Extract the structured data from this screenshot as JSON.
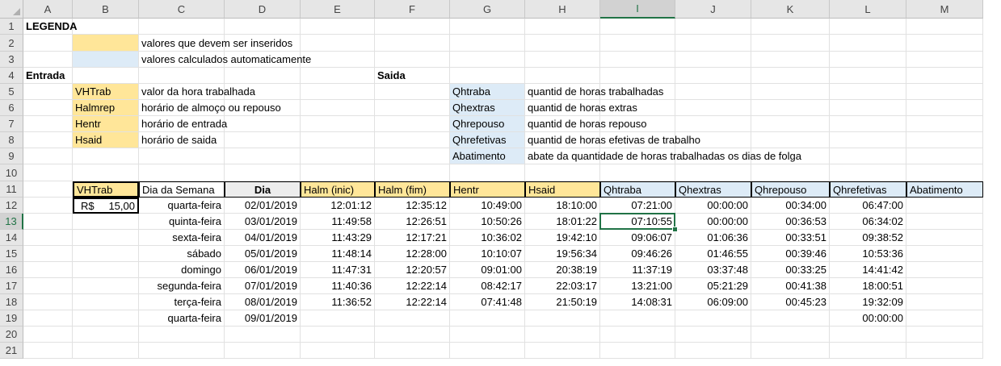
{
  "columns": [
    "A",
    "B",
    "C",
    "D",
    "E",
    "F",
    "G",
    "H",
    "I",
    "J",
    "K",
    "L",
    "M"
  ],
  "rows": [
    "1",
    "2",
    "3",
    "4",
    "5",
    "6",
    "7",
    "8",
    "9",
    "10",
    "11",
    "12",
    "13",
    "14",
    "15",
    "16",
    "17",
    "18",
    "19",
    "20",
    "21"
  ],
  "legend": {
    "title": "LEGENDA",
    "input_desc": "valores que devem ser inseridos",
    "calc_desc": "valores calculados automaticamente",
    "entrada": "Entrada",
    "saida": "Saida",
    "inputs": [
      {
        "code": "VHTrab",
        "desc": "valor da hora trabalhada"
      },
      {
        "code": "Halmrep",
        "desc": "horário de almoço ou repouso"
      },
      {
        "code": "Hentr",
        "desc": "horário de entrada"
      },
      {
        "code": "Hsaid",
        "desc": "horário de saida"
      }
    ],
    "outputs": [
      {
        "code": "Qhtraba",
        "desc": "quantid de horas trabalhadas"
      },
      {
        "code": "Qhextras",
        "desc": "quantid de horas extras"
      },
      {
        "code": "Qhrepouso",
        "desc": "quantid de horas repouso"
      },
      {
        "code": "Qhrefetivas",
        "desc": "quantid de horas efetivas de trabalho"
      },
      {
        "code": "Abatimento",
        "desc": "abate da quantidade de horas trabalhadas os dias de folga"
      }
    ]
  },
  "vhtrab": {
    "label": "VHTrab",
    "currency": "R$",
    "amount": "15,00"
  },
  "table": {
    "headers": [
      "Dia da Semana",
      "Dia",
      "Halm (inic)",
      "Halm (fim)",
      "Hentr",
      "Hsaid",
      "Qhtraba",
      "Qhextras",
      "Qhrepouso",
      "Qhrefetivas",
      "Abatimento"
    ],
    "rows": [
      [
        "quarta-feira",
        "02/01/2019",
        "12:01:12",
        "12:35:12",
        "10:49:00",
        "18:10:00",
        "07:21:00",
        "00:00:00",
        "00:34:00",
        "06:47:00",
        ""
      ],
      [
        "quinta-feira",
        "03/01/2019",
        "11:49:58",
        "12:26:51",
        "10:50:26",
        "18:01:22",
        "07:10:55",
        "00:00:00",
        "00:36:53",
        "06:34:02",
        ""
      ],
      [
        "sexta-feira",
        "04/01/2019",
        "11:43:29",
        "12:17:21",
        "10:36:02",
        "19:42:10",
        "09:06:07",
        "01:06:36",
        "00:33:51",
        "09:38:52",
        ""
      ],
      [
        "sábado",
        "05/01/2019",
        "11:48:14",
        "12:28:00",
        "10:10:07",
        "19:56:34",
        "09:46:26",
        "01:46:55",
        "00:39:46",
        "10:53:36",
        ""
      ],
      [
        "domingo",
        "06/01/2019",
        "11:47:31",
        "12:20:57",
        "09:01:00",
        "20:38:19",
        "11:37:19",
        "03:37:48",
        "00:33:25",
        "14:41:42",
        ""
      ],
      [
        "segunda-feira",
        "07/01/2019",
        "11:40:36",
        "12:22:14",
        "08:42:17",
        "22:03:17",
        "13:21:00",
        "05:21:29",
        "00:41:38",
        "18:00:51",
        ""
      ],
      [
        "terça-feira",
        "08/01/2019",
        "11:36:52",
        "12:22:14",
        "07:41:48",
        "21:50:19",
        "14:08:31",
        "06:09:00",
        "00:45:23",
        "19:32:09",
        ""
      ],
      [
        "quarta-feira",
        "09/01/2019",
        "",
        "",
        "",
        "",
        "",
        "",
        "",
        "00:00:00",
        ""
      ]
    ]
  },
  "selection": {
    "column": "I",
    "row": "13"
  },
  "colors": {
    "input": "#ffe699",
    "calc": "#ddebf7",
    "header_grey": "#ededed",
    "excel_green": "#217346"
  }
}
